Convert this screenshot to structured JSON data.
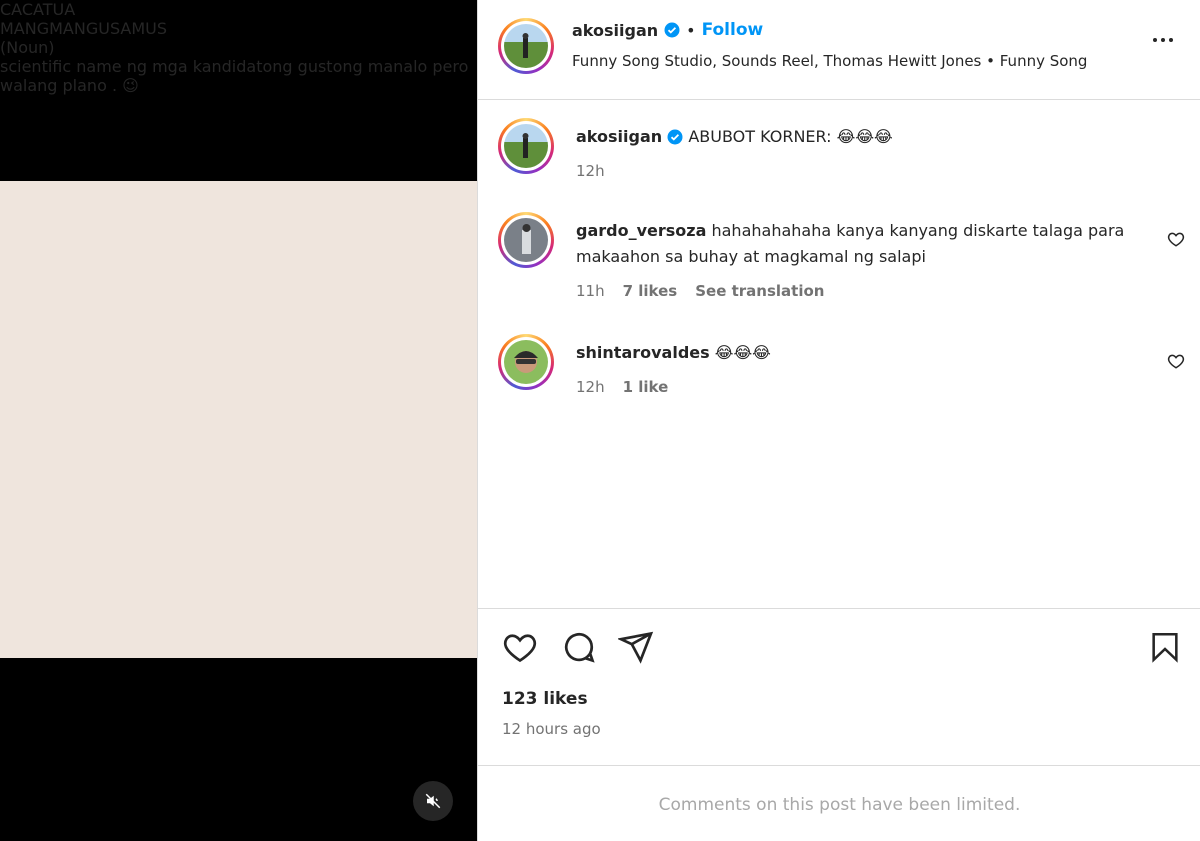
{
  "media": {
    "title_line1": "CACATUA",
    "title_line2": "MANGMANGUSAMUS",
    "pos": "(Noun)",
    "definition": "scientific name ng mga kandidatong gustong manalo pero walang plano . 😉",
    "mute_icon": "speaker-muted-icon"
  },
  "header": {
    "username": "akosiigan",
    "separator": "•",
    "follow_label": "Follow",
    "audio": "Funny Song Studio, Sounds Reel, Thomas Hewitt Jones • Funny Song"
  },
  "caption": {
    "username": "akosiigan",
    "text": "ABUBOT KORNER: 😂😂😂",
    "time": "12h"
  },
  "comments": [
    {
      "username": "gardo_versoza",
      "text": "hahahahahaha kanya kanyang diskarte talaga para makaahon sa buhay at magkamal ng salapi",
      "time": "11h",
      "likes": "7 likes",
      "translate": "See translation"
    },
    {
      "username": "shintarovaldes",
      "text": "😂😂😂",
      "time": "12h",
      "likes": "1 like"
    }
  ],
  "footer": {
    "likes": "123 likes",
    "time_ago": "12 hours ago",
    "limited": "Comments on this post have been limited."
  },
  "colors": {
    "accent": "#0095f6",
    "muted": "#737373",
    "card_bg": "#efe5dd"
  }
}
